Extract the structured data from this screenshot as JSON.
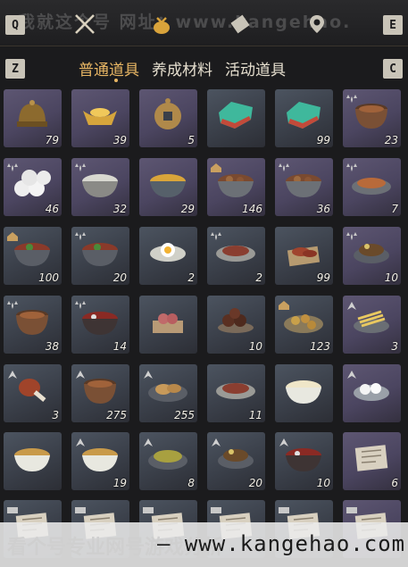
{
  "topbar": {
    "watermark": "我就这个号 网址：www.kangehao.",
    "key_left": "Q",
    "key_right": "E"
  },
  "tabs": {
    "key_left": "Z",
    "key_right": "C",
    "items": [
      "普通道具",
      "养成材料",
      "活动道具"
    ],
    "active_index": 0
  },
  "items": [
    {
      "name": "helmet-icon",
      "qty": "79",
      "badge": ""
    },
    {
      "name": "gold-ingot-icon",
      "qty": "39",
      "badge": ""
    },
    {
      "name": "coin-icon",
      "qty": "5",
      "badge": ""
    },
    {
      "name": "jade-icon",
      "qty": "",
      "badge": ""
    },
    {
      "name": "jade-icon",
      "qty": "99",
      "badge": ""
    },
    {
      "name": "clay-pot-icon",
      "qty": "23",
      "badge": "buff"
    },
    {
      "name": "dumplings-icon",
      "qty": "46",
      "badge": "buff"
    },
    {
      "name": "rice-bowl-icon",
      "qty": "32",
      "badge": "buff"
    },
    {
      "name": "soup-bowl-icon",
      "qty": "29",
      "badge": ""
    },
    {
      "name": "meat-bowl-icon",
      "qty": "146",
      "badge": "house"
    },
    {
      "name": "meat-bowl-icon",
      "qty": "36",
      "badge": "buff"
    },
    {
      "name": "fish-dish-icon",
      "qty": "7",
      "badge": "buff"
    },
    {
      "name": "stew-bowl-icon",
      "qty": "100",
      "badge": "house"
    },
    {
      "name": "stew-bowl-icon",
      "qty": "20",
      "badge": "buff"
    },
    {
      "name": "egg-dish-icon",
      "qty": "2",
      "badge": ""
    },
    {
      "name": "sliced-meat-icon",
      "qty": "2",
      "badge": "buff"
    },
    {
      "name": "skewer-icon",
      "qty": "99",
      "badge": ""
    },
    {
      "name": "mixed-dish-icon",
      "qty": "10",
      "badge": "buff"
    },
    {
      "name": "clay-pot-icon",
      "qty": "38",
      "badge": "buff"
    },
    {
      "name": "spicy-bowl-icon",
      "qty": "14",
      "badge": "buff"
    },
    {
      "name": "cake-icon",
      "qty": "",
      "badge": ""
    },
    {
      "name": "meatballs-icon",
      "qty": "10",
      "badge": ""
    },
    {
      "name": "egg-plate-icon",
      "qty": "123",
      "badge": "house"
    },
    {
      "name": "noodles-icon",
      "qty": "3",
      "badge": "up"
    },
    {
      "name": "drumstick-icon",
      "qty": "3",
      "badge": "up"
    },
    {
      "name": "clay-pot-icon",
      "qty": "275",
      "badge": "up"
    },
    {
      "name": "bun-plate-icon",
      "qty": "255",
      "badge": "up"
    },
    {
      "name": "sliced-meat-icon",
      "qty": "11",
      "badge": ""
    },
    {
      "name": "tofu-soup-icon",
      "qty": "",
      "badge": ""
    },
    {
      "name": "tangyuan-icon",
      "qty": "",
      "badge": "up"
    },
    {
      "name": "noodle-bowl-icon",
      "qty": "",
      "badge": ""
    },
    {
      "name": "noodle-bowl-icon",
      "qty": "19",
      "badge": "up"
    },
    {
      "name": "greens-plate-icon",
      "qty": "8",
      "badge": "up"
    },
    {
      "name": "mixed-dish-icon",
      "qty": "20",
      "badge": "up"
    },
    {
      "name": "spicy-bowl-icon",
      "qty": "10",
      "badge": "up"
    },
    {
      "name": "scroll-recipe-icon",
      "qty": "6",
      "badge": ""
    },
    {
      "name": "scroll-recipe-icon",
      "qty": "",
      "badge": "tag"
    },
    {
      "name": "scroll-recipe-icon",
      "qty": "",
      "badge": "tag"
    },
    {
      "name": "scroll-recipe-icon",
      "qty": "",
      "badge": "tag"
    },
    {
      "name": "scroll-recipe-icon",
      "qty": "",
      "badge": "tag"
    },
    {
      "name": "scroll-recipe-icon",
      "qty": "",
      "badge": "tag"
    },
    {
      "name": "scroll-recipe-icon",
      "qty": "",
      "badge": "tag"
    }
  ],
  "bottom_watermark": {
    "left_text": "看个号专业网号游戏分析",
    "url": "— www.kangehao.com"
  }
}
